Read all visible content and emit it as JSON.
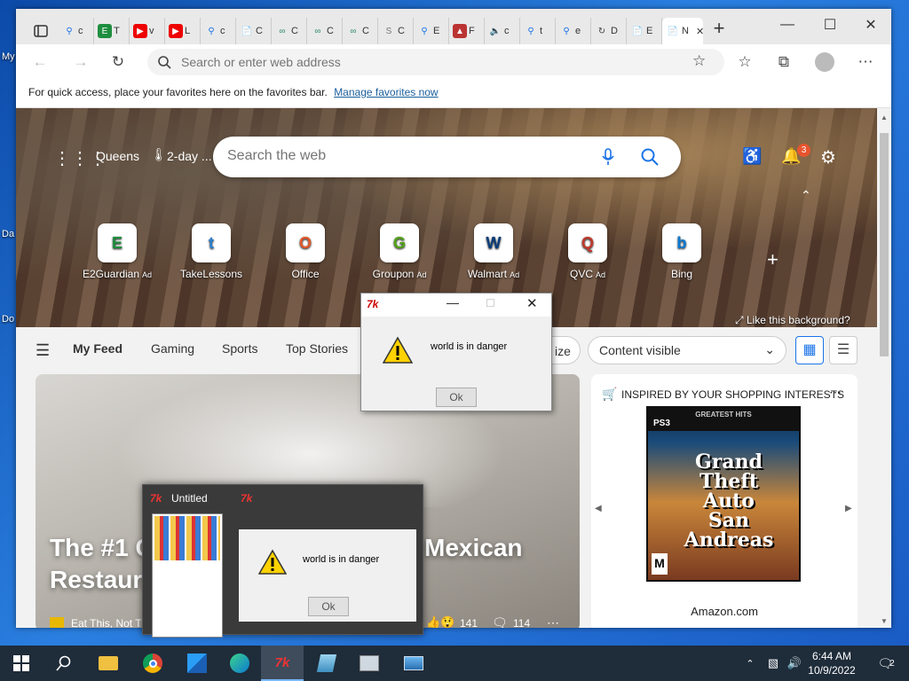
{
  "desktop": {
    "icons": [
      "My",
      "Da",
      "Do"
    ]
  },
  "browser": {
    "tabs": [
      {
        "icon": "search-icon",
        "label": "c",
        "color": "#1a73e8"
      },
      {
        "icon": "green-e-icon",
        "label": "T",
        "color": "#1e8e3e"
      },
      {
        "icon": "youtube-icon",
        "label": "v",
        "color": "#e00"
      },
      {
        "icon": "youtube-icon",
        "label": "L",
        "color": "#e00"
      },
      {
        "icon": "search-icon",
        "label": "c",
        "color": "#1a73e8"
      },
      {
        "icon": "page-icon",
        "label": "C",
        "color": "#555"
      },
      {
        "icon": "green-swirl-icon",
        "label": "C",
        "color": "#2a8a6a"
      },
      {
        "icon": "green-swirl-icon",
        "label": "C",
        "color": "#2a8a6a"
      },
      {
        "icon": "green-swirl-icon",
        "label": "C",
        "color": "#2a8a6a"
      },
      {
        "icon": "sst-icon",
        "label": "C",
        "color": "#777"
      },
      {
        "icon": "search-icon",
        "label": "E",
        "color": "#1a73e8"
      },
      {
        "icon": "game-icon",
        "label": "F",
        "color": "#b33"
      },
      {
        "icon": "speaker-icon",
        "label": "c",
        "color": "#444"
      },
      {
        "icon": "search-icon",
        "label": "t",
        "color": "#1a73e8"
      },
      {
        "icon": "search-icon",
        "label": "e",
        "color": "#1a73e8"
      },
      {
        "icon": "refresh-icon",
        "label": "D",
        "color": "#444"
      },
      {
        "icon": "page-icon",
        "label": "E",
        "color": "#555"
      },
      {
        "icon": "tab-icon",
        "label": "N",
        "color": "#555"
      }
    ],
    "address_placeholder": "Search or enter web address",
    "favbar_text": "For quick access, place your favorites here on the favorites bar.",
    "favbar_link": "Manage favorites now"
  },
  "newtab": {
    "location": "Queens",
    "weather": "2-day ...",
    "search_placeholder": "Search the web",
    "notif_count": "3",
    "like_bg": "Like this background?",
    "quicklinks": [
      {
        "label": "E2Guardian",
        "ad": "Ad",
        "glyph": "E",
        "color": "#1e8e3e"
      },
      {
        "label": "TakeLessons",
        "ad": "",
        "glyph": "t",
        "color": "#2a7fd0"
      },
      {
        "label": "Office",
        "ad": "",
        "glyph": "O",
        "color": "#e3572a"
      },
      {
        "label": "Groupon",
        "ad": "Ad",
        "glyph": "G",
        "color": "#53a318"
      },
      {
        "label": "Walmart",
        "ad": "Ad",
        "glyph": "W",
        "color": "#0a3d7a"
      },
      {
        "label": "QVC",
        "ad": "Ad",
        "glyph": "Q",
        "color": "#c0392b"
      },
      {
        "label": "Bing",
        "ad": "",
        "glyph": "b",
        "color": "#0a7ad4"
      }
    ],
    "feed_tabs": [
      "My Feed",
      "Gaming",
      "Sports",
      "Top Stories"
    ],
    "personalize_partial": "ize",
    "content_select": "Content visible",
    "headline": "The #1 C... Mexican Restaura...",
    "headline_left1": "The #1 C",
    "headline_right1": "Mexican",
    "headline_left2": "Restaura",
    "source": "Eat This, Not Th",
    "likes": "141",
    "comments": "114",
    "shopping_title": "INSPIRED BY YOUR SHOPPING INTERESTS",
    "ps3_tag": "GREATEST HITS",
    "ps3_logo": "PS3",
    "game_title": "Grand Theft Auto San Andreas",
    "rating": "M",
    "shop_source": "Amazon.com"
  },
  "dialog": {
    "message": "world is in danger",
    "ok": "Ok"
  },
  "preview": {
    "title": "Untitled",
    "message": "world is in danger",
    "ok": "Ok"
  },
  "taskbar": {
    "time": "6:44 AM",
    "date": "10/9/2022",
    "notif": "2"
  }
}
